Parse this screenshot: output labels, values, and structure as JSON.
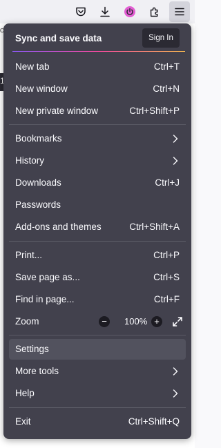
{
  "toolbar": {
    "icons": [
      "pocket-icon",
      "downloads-icon",
      "extension-power-icon",
      "extensions-icon",
      "app-menu-icon"
    ],
    "colors": {
      "power_badge": "#e25ed2"
    }
  },
  "behind": {
    "text_1": "C",
    "text_2": "1"
  },
  "menu": {
    "sync": {
      "title": "Sync and save data",
      "sign_in": "Sign In"
    },
    "new_tab": {
      "label": "New tab",
      "shortcut": "Ctrl+T"
    },
    "new_window": {
      "label": "New window",
      "shortcut": "Ctrl+N"
    },
    "new_private_window": {
      "label": "New private window",
      "shortcut": "Ctrl+Shift+P"
    },
    "bookmarks": {
      "label": "Bookmarks"
    },
    "history": {
      "label": "History"
    },
    "downloads": {
      "label": "Downloads",
      "shortcut": "Ctrl+J"
    },
    "passwords": {
      "label": "Passwords"
    },
    "addons": {
      "label": "Add-ons and themes",
      "shortcut": "Ctrl+Shift+A"
    },
    "print": {
      "label": "Print...",
      "shortcut": "Ctrl+P"
    },
    "save_page": {
      "label": "Save page as...",
      "shortcut": "Ctrl+S"
    },
    "find": {
      "label": "Find in page...",
      "shortcut": "Ctrl+F"
    },
    "zoom": {
      "label": "Zoom",
      "value": "100%",
      "minus": "−",
      "plus": "+"
    },
    "settings": {
      "label": "Settings"
    },
    "more_tools": {
      "label": "More tools"
    },
    "help": {
      "label": "Help"
    },
    "exit": {
      "label": "Exit",
      "shortcut": "Ctrl+Shift+Q"
    }
  },
  "colors": {
    "panel_bg": "#42414d",
    "hover_bg": "#52525e",
    "text": "#fbfbfe",
    "separator": "#5b5b66"
  }
}
